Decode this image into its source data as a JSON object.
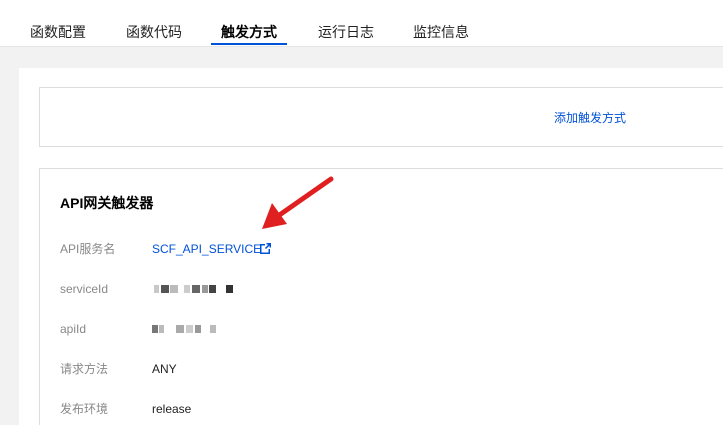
{
  "tabs": [
    {
      "label": "函数配置"
    },
    {
      "label": "函数代码"
    },
    {
      "label": "触发方式"
    },
    {
      "label": "运行日志"
    },
    {
      "label": "监控信息"
    }
  ],
  "active_tab": "触发方式",
  "add_panel": {
    "add_trigger_link": "添加触发方式"
  },
  "trigger": {
    "title": "API网关触发器",
    "rows": [
      {
        "label": "API服务名",
        "value": "SCF_API_SERVICE"
      },
      {
        "label": "serviceId",
        "value": ""
      },
      {
        "label": "apiId",
        "value": ""
      },
      {
        "label": "请求方法",
        "value": "ANY"
      },
      {
        "label": "发布环境",
        "value": "release"
      }
    ]
  },
  "colors": {
    "accent": "#0052d9",
    "annotation_arrow": "#e02020"
  },
  "icons": {
    "external_link": "external-link-icon"
  }
}
